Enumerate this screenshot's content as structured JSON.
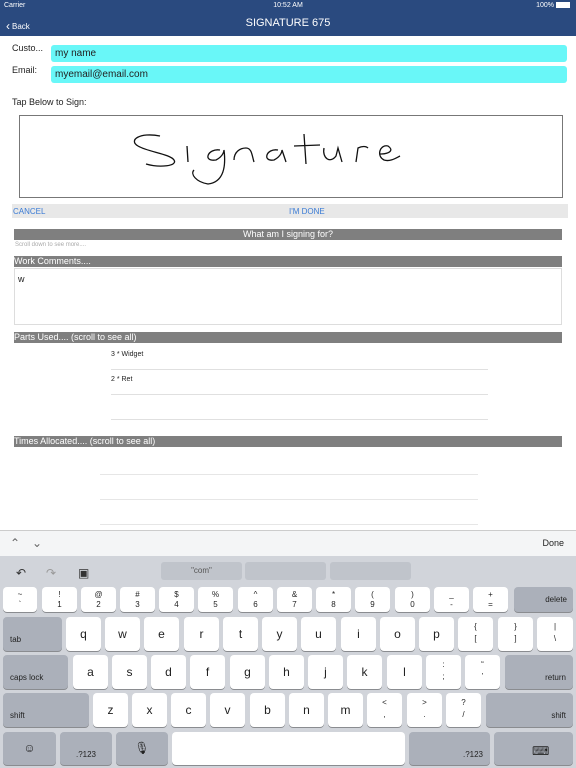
{
  "status": {
    "carrier": "Carrier",
    "time": "10:52 AM",
    "battery": "100%"
  },
  "nav": {
    "back": "Back",
    "title": "SIGNATURE 675"
  },
  "form": {
    "customer_label": "Custo...",
    "customer_value": "my name",
    "email_label": "Email:",
    "email_value": "myemail@email.com",
    "tap_label": "Tap Below to Sign:",
    "cancel": "CANCEL",
    "done": "I'M DONE"
  },
  "signing": {
    "header": "What am I signing for?",
    "scroll_note": "Scroll down to see more....",
    "comments_header": "Work Comments....",
    "comments_value": "w",
    "parts_header": "Parts Used.... (scroll to see all)",
    "parts": [
      "3 * Widget",
      "2 * Ret"
    ],
    "times_header": "Times Allocated.... (scroll to see all)"
  },
  "accessory": {
    "done": "Done"
  },
  "keyboard": {
    "suggestion": "\"com\"",
    "row0": [
      {
        "top": "~",
        "bot": "`"
      },
      {
        "top": "!",
        "bot": "1"
      },
      {
        "top": "@",
        "bot": "2"
      },
      {
        "top": "$",
        "bot": "4"
      },
      {
        "top": "%",
        "bot": "5"
      },
      {
        "top": "^",
        "bot": "6"
      },
      {
        "top": "&",
        "bot": "7"
      },
      {
        "top": "*",
        "bot": "8"
      },
      {
        "top": "(",
        "bot": "9"
      },
      {
        "top": ")",
        "bot": "0"
      },
      {
        "top": "_",
        "bot": "-"
      },
      {
        "top": "+",
        "bot": "="
      }
    ],
    "row0_fixes": {
      "3": "#",
      "3b": "3"
    },
    "delete": "delete",
    "tab": "tab",
    "row1": [
      "q",
      "w",
      "e",
      "r",
      "t",
      "y",
      "u",
      "i",
      "o",
      "p"
    ],
    "brace": {
      "top": "{",
      "bot": "["
    },
    "brace2": {
      "top": "}",
      "bot": "]"
    },
    "pipe": {
      "top": "|",
      "bot": "\\"
    },
    "caps": "caps lock",
    "row2": [
      "a",
      "s",
      "d",
      "f",
      "g",
      "h",
      "j",
      "k",
      "l"
    ],
    "semi": {
      "top": ":",
      "bot": ";"
    },
    "quote": {
      "top": "“",
      "bot": "’"
    },
    "return": "return",
    "shift": "shift",
    "row3": [
      "z",
      "x",
      "c",
      "v",
      "b",
      "n",
      "m"
    ],
    "comma": {
      "top": "<",
      "bot": ","
    },
    "period": {
      "top": ">",
      "bot": "."
    },
    "slash": {
      "top": "?",
      "bot": "/"
    },
    "num": ".?123"
  }
}
